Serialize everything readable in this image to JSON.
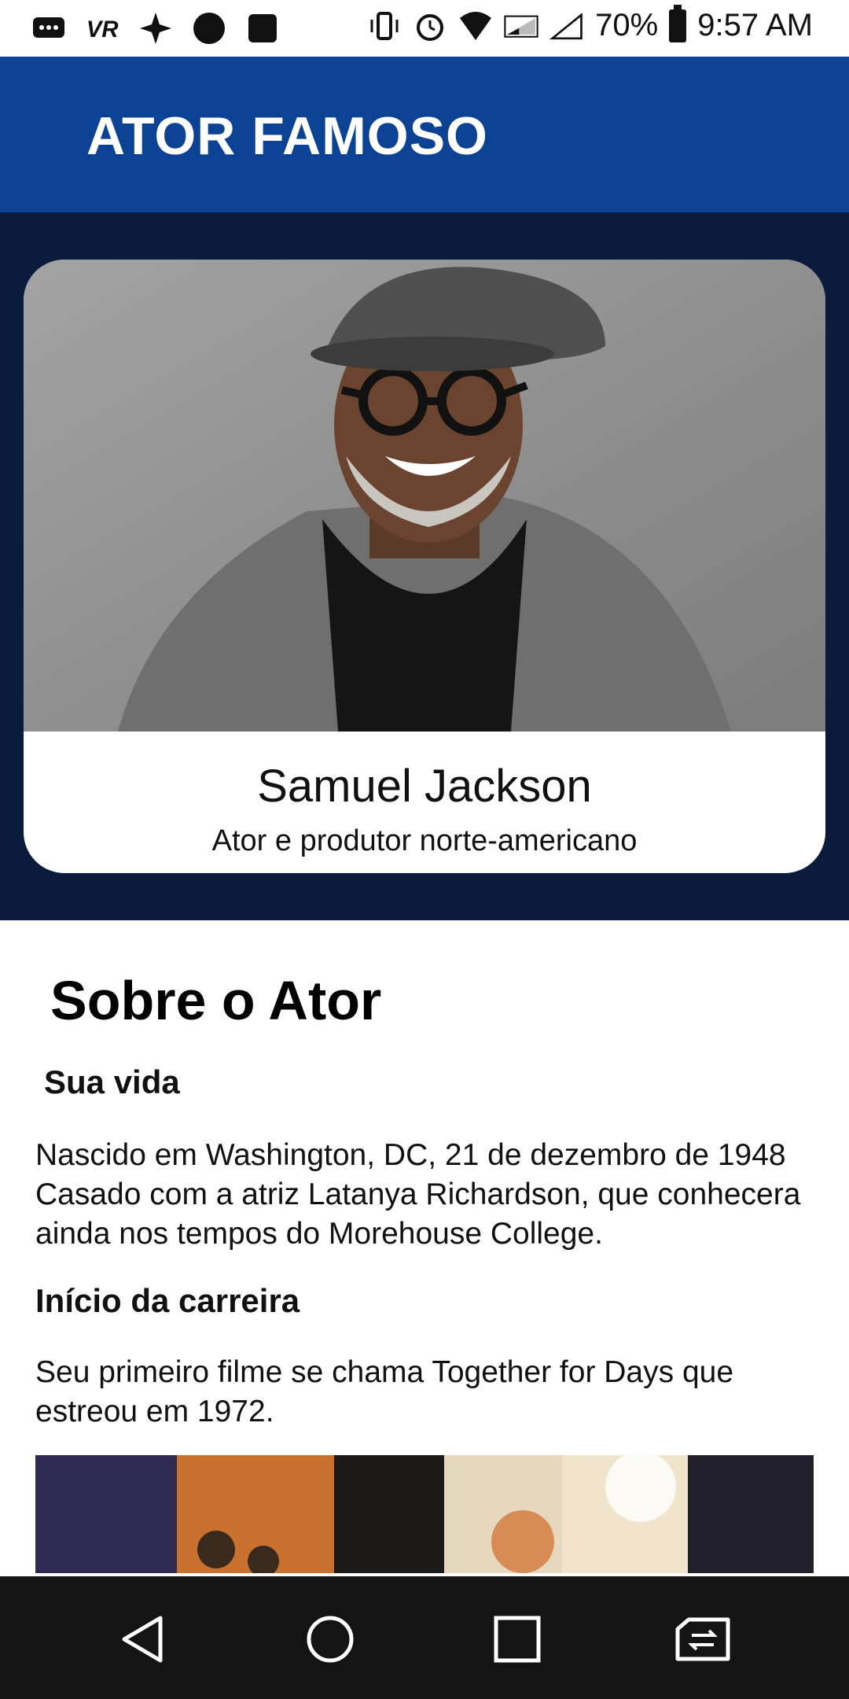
{
  "status_bar": {
    "battery": "70%",
    "time": "9:57 AM"
  },
  "app_bar": {
    "title": "ATOR FAMOSO"
  },
  "actor_card": {
    "name": "Samuel Jackson",
    "subtitle": "Ator e produtor norte-americano"
  },
  "about": {
    "title": "Sobre o Ator",
    "life_heading": "Sua vida",
    "life_text": " Nascido em Washington, DC, 21 de dezembro de 1948 Casado com a atriz Latanya Richardson, que conhecera ainda nos tempos do Morehouse College.",
    "career_heading": "Início da carreira",
    "career_text": "Seu primeiro filme se chama Together for Days que estreou em 1972."
  },
  "nav": {
    "icons": [
      "back-icon",
      "home-icon",
      "recents-icon",
      "switch-sim-icon"
    ]
  },
  "colors": {
    "app_bar": "#0c4293",
    "hero_bg": "#0b1b3d",
    "nav_bg": "#141414"
  }
}
